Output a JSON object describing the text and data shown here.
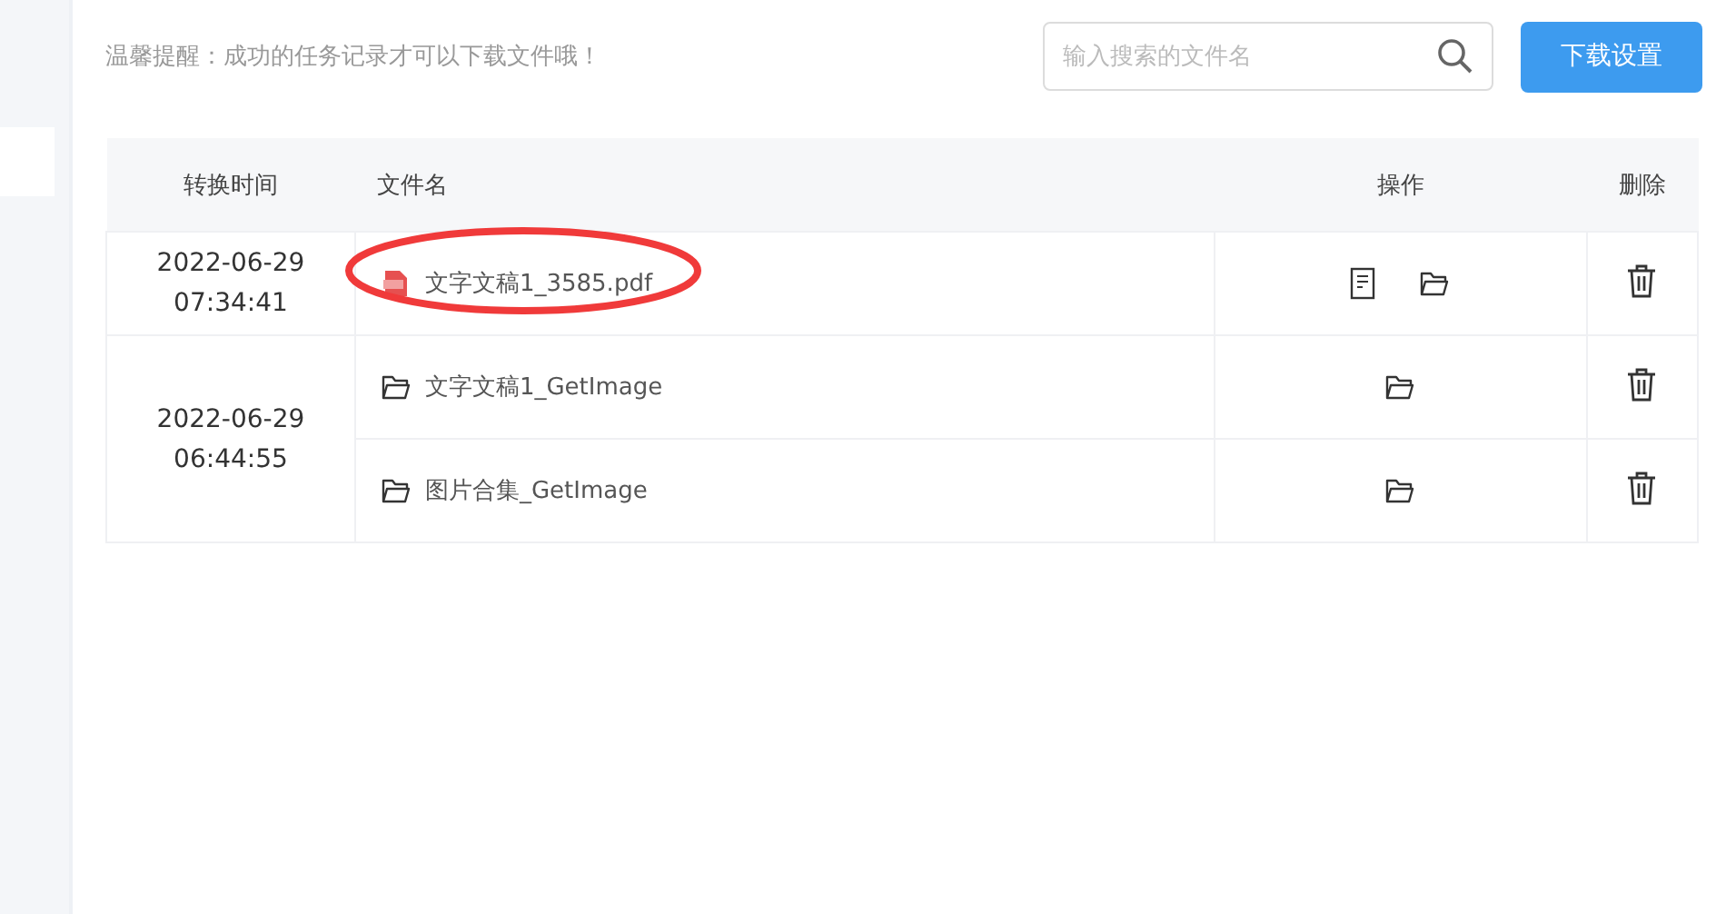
{
  "hint": "温馨提醒：成功的任务记录才可以下载文件哦！",
  "search": {
    "placeholder": "输入搜索的文件名"
  },
  "settings_button": "下载设置",
  "table": {
    "columns": [
      "转换时间",
      "文件名",
      "操作",
      "删除"
    ],
    "groups": [
      {
        "time": [
          "2022-06-29",
          "07:34:41"
        ],
        "files": [
          {
            "name": "文字文稿1_3585.pdf",
            "kind": "pdf",
            "actions": [
              {
                "kind": "document"
              },
              {
                "kind": "folder"
              }
            ],
            "circled": true
          }
        ]
      },
      {
        "time": [
          "2022-06-29",
          "06:44:55"
        ],
        "files": [
          {
            "name": "文字文稿1_GetImage",
            "kind": "folder",
            "actions": [
              {
                "kind": "folder"
              }
            ],
            "circled": false
          },
          {
            "name": "图片合集_GetImage",
            "kind": "folder",
            "actions": [
              {
                "kind": "folder"
              }
            ],
            "circled": false
          }
        ]
      }
    ]
  }
}
